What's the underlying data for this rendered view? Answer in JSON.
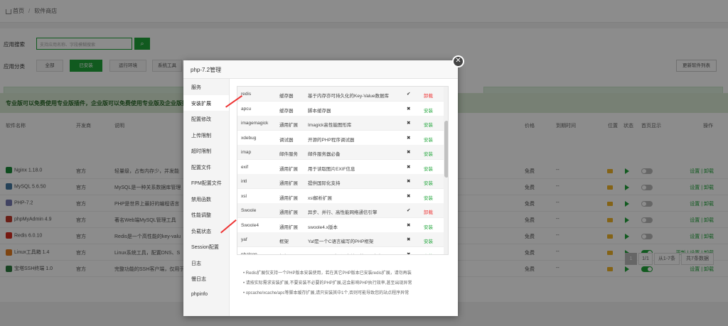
{
  "breadcrumb": {
    "home": "首页",
    "current": "软件商店"
  },
  "search": {
    "label": "应用搜索",
    "placeholder": "支持应用名称、字段模糊搜索",
    "icon": "search-icon"
  },
  "categories": {
    "label": "应用分类",
    "items": [
      "全部",
      "已安装",
      "运行环境",
      "系统工具"
    ],
    "active": "已安装",
    "update_button": "更新软件列表"
  },
  "banners": {
    "left": "堡塔运维直播答疑",
    "right": "精品软件推荐"
  },
  "promo": "专业版可以免费使用专业版插件，企业版可以免费使用专业版及企业版插",
  "table": {
    "headers": [
      "软件名称",
      "开发商",
      "说明",
      "价格",
      "到期时间",
      "位置",
      "状态",
      "首页显示",
      "操作"
    ],
    "rows": [
      {
        "name": "Nginx 1.18.0",
        "vendor": "官方",
        "desc": "轻量级，占有内存少，并发能",
        "price": "免费",
        "expire": "--",
        "home": false,
        "ops": "设置 | 卸载",
        "icon_color": "#1a8a3a"
      },
      {
        "name": "MySQL 5.6.50",
        "vendor": "官方",
        "desc": "MySQL是一种关系数据库管理",
        "price": "免费",
        "expire": "--",
        "home": false,
        "ops": "设置 | 卸载",
        "icon_color": "#4479a1"
      },
      {
        "name": "PHP-7.2",
        "vendor": "官方",
        "desc": "PHP是世界上最好的编程语言",
        "price": "免费",
        "expire": "--",
        "home": false,
        "ops": "设置 | 卸载",
        "icon_color": "#777bb3"
      },
      {
        "name": "phpMyAdmin 4.9",
        "vendor": "官方",
        "desc": "著名Web端MySQL管理工具",
        "price": "免费",
        "expire": "--",
        "home": false,
        "ops": "设置 | 卸载",
        "icon_color": "#c0392b"
      },
      {
        "name": "Redis 6.0.10",
        "vendor": "官方",
        "desc": "Redis是一个高性能的key-valu",
        "price": "免费",
        "expire": "--",
        "home": false,
        "ops": "设置 | 卸载",
        "icon_color": "#d82c20"
      },
      {
        "name": "Linux工具箱 1.4",
        "vendor": "官方",
        "desc": "Linux系统工具，配置DNS、S",
        "price": "免费",
        "expire": "--",
        "home": true,
        "ops": "更新 | 设置 | 卸载",
        "icon_color": "#e67e22"
      },
      {
        "name": "宝塔SSH终端 1.0",
        "vendor": "官方",
        "desc": "完整功能的SSH客户端，仅用于",
        "price": "免费",
        "expire": "--",
        "home": true,
        "ops": "设置 | 卸载",
        "icon_color": "#2c7a3f"
      }
    ]
  },
  "pagination": {
    "current": "1",
    "total_pages": "1/1",
    "range": "从1-7条",
    "total": "共7条数据"
  },
  "modal": {
    "title": "php-7.2管理",
    "sidebar": [
      "服务",
      "安装扩展",
      "配置修改",
      "上传限制",
      "超时限制",
      "配置文件",
      "FPM配置文件",
      "禁用函数",
      "性能调整",
      "负载状态",
      "Session配置",
      "日志",
      "慢日志",
      "phpinfo"
    ],
    "active_tab": "安装扩展",
    "extensions": [
      {
        "name": "redis",
        "type": "缓存器",
        "desc": "基于内存亦可持久化的Key-Value数据库",
        "installed": true,
        "action": "卸载"
      },
      {
        "name": "apcu",
        "type": "缓存器",
        "desc": "脚本缓存器",
        "installed": false,
        "action": "安装"
      },
      {
        "name": "imagemagick",
        "type": "通用扩展",
        "desc": "Imagick高性能图形库",
        "installed": false,
        "action": "安装"
      },
      {
        "name": "xdebug",
        "type": "调试器",
        "desc": "开源的PHP程序调试器",
        "installed": false,
        "action": "安装"
      },
      {
        "name": "imap",
        "type": "邮件服务",
        "desc": "邮件服务器必备",
        "installed": false,
        "action": "安装"
      },
      {
        "name": "exif",
        "type": "通用扩展",
        "desc": "用于读取图片EXIF信息",
        "installed": false,
        "action": "安装"
      },
      {
        "name": "intl",
        "type": "通用扩展",
        "desc": "提供国际化支持",
        "installed": false,
        "action": "安装"
      },
      {
        "name": "xsl",
        "type": "通用扩展",
        "desc": "xsl解析扩展",
        "installed": false,
        "action": "安装"
      },
      {
        "name": "Swoole",
        "type": "通用扩展",
        "desc": "异步、并行、高性能网络通信引擎",
        "installed": true,
        "action": "卸载"
      },
      {
        "name": "Swoole4",
        "type": "通用扩展",
        "desc": "swoole4.x版本",
        "installed": false,
        "action": "安装"
      },
      {
        "name": "yaf",
        "type": "框架",
        "desc": "Yaf是一个C语言编写的PHP框架",
        "installed": false,
        "action": "安装"
      },
      {
        "name": "phalcon",
        "type": "框架",
        "desc": "phalcon是一个C语言编写的PHP框架",
        "installed": false,
        "action": "安装"
      }
    ],
    "notes": [
      "Redis扩展仅支持一个PHP版本安装使用，若在其它PHP版本已安装redis扩展，请勿再装",
      "请按实际需求安装扩展,不要安装不必要的PHP扩展,这会影响PHP执行效率,甚至出现异常",
      "opcache/xcache/apc等脚本缓存扩展,请只安装其中1个,否则可能导致您的站点程序异常"
    ]
  }
}
